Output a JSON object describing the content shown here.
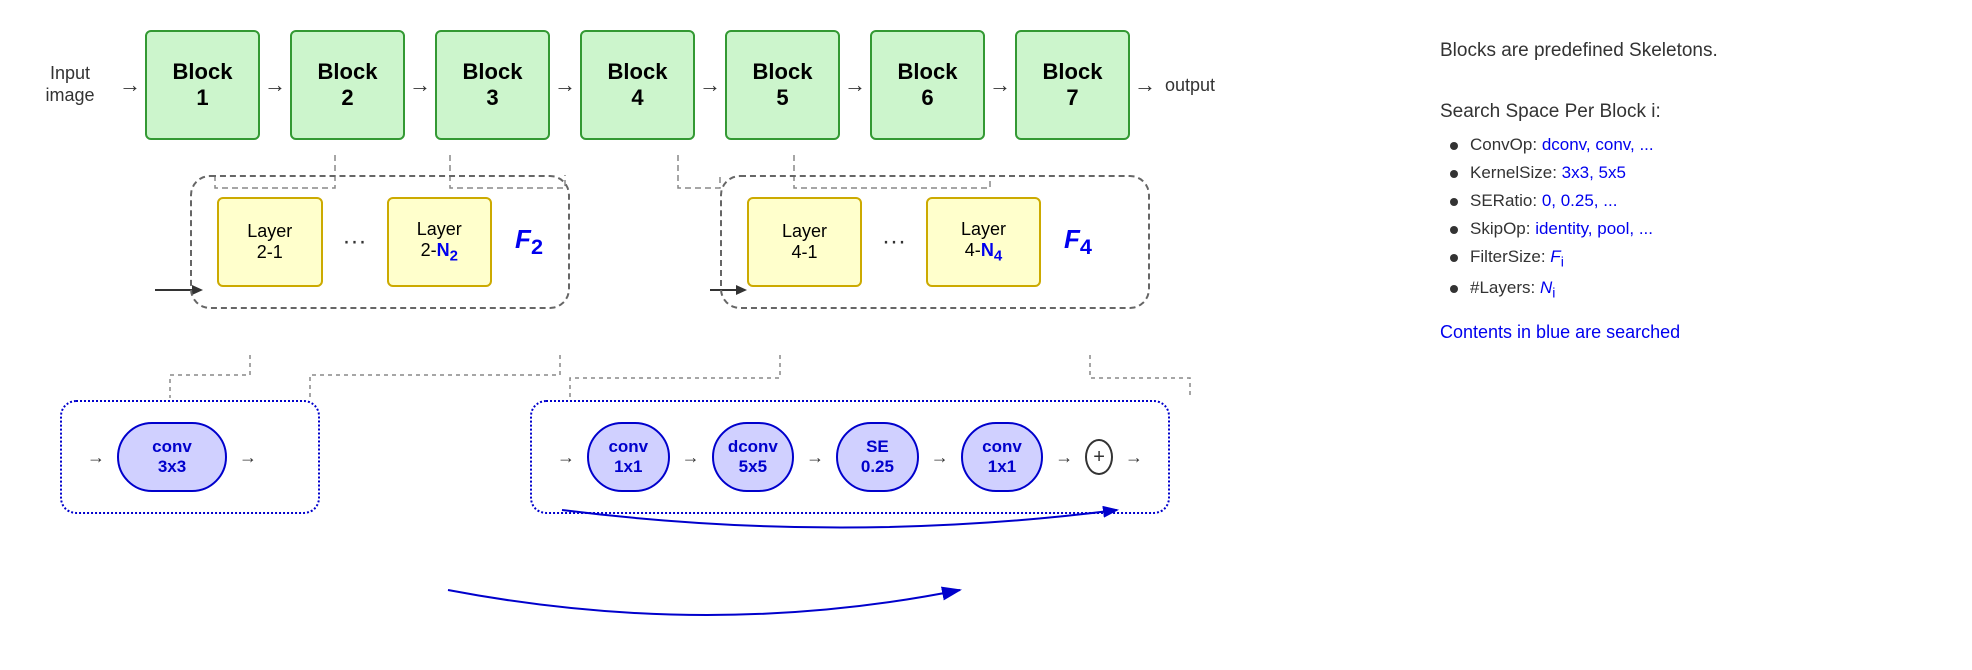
{
  "diagram": {
    "input_label": "Input\nimage",
    "output_label": "output",
    "blocks": [
      {
        "id": "b1",
        "line1": "Block",
        "line2": "1"
      },
      {
        "id": "b2",
        "line1": "Block",
        "line2": "2"
      },
      {
        "id": "b3",
        "line1": "Block",
        "line2": "3"
      },
      {
        "id": "b4",
        "line1": "Block",
        "line2": "4"
      },
      {
        "id": "b5",
        "line1": "Block",
        "line2": "5"
      },
      {
        "id": "b6",
        "line1": "Block",
        "line2": "6"
      },
      {
        "id": "b7",
        "line1": "Block",
        "line2": "7"
      }
    ],
    "expand_left": {
      "layer1": {
        "line1": "Layer",
        "line2": "2-1"
      },
      "layer2_line1": "Layer",
      "layer2_line2": "2-",
      "layer2_bold": "N",
      "layer2_sub": "2",
      "f_label": "F",
      "f_sub": "2"
    },
    "expand_right": {
      "layer1": {
        "line1": "Layer",
        "line2": "4-1"
      },
      "layer2_line1": "Layer",
      "layer2_line2": "4-",
      "layer2_bold": "N",
      "layer2_sub": "4",
      "f_label": "F",
      "f_sub": "4"
    },
    "bottom_left": {
      "oval": {
        "line1": "conv",
        "line2": "3x3"
      }
    },
    "bottom_right": {
      "oval1": {
        "line1": "conv",
        "line2": "1x1"
      },
      "oval2": {
        "line1": "dconv",
        "line2": "5x5"
      },
      "oval3": {
        "line1": "SE",
        "line2": "0.25"
      },
      "oval4": {
        "line1": "conv",
        "line2": "1x1"
      },
      "plus": "+"
    }
  },
  "panel": {
    "title": "Blocks are predefined Skeletons.",
    "subtitle": "Search Space Per Block i:",
    "bullets": [
      {
        "label": "ConvOp:",
        "value": "dconv, conv, ...",
        "blue": true
      },
      {
        "label": "KernelSize:",
        "value": "3x3, 5x5",
        "blue": true
      },
      {
        "label": "SERatio:",
        "value": "0, 0.25, ...",
        "blue": true
      },
      {
        "label": "SkipOp:",
        "value": "identity, pool, ...",
        "blue": true
      },
      {
        "label": "FilterSize:",
        "value": "F",
        "sub": "i",
        "blue": true
      },
      {
        "label": "#Layers:",
        "value": "N",
        "sub": "i",
        "blue": true
      }
    ],
    "note": "Contents in blue are searched"
  }
}
